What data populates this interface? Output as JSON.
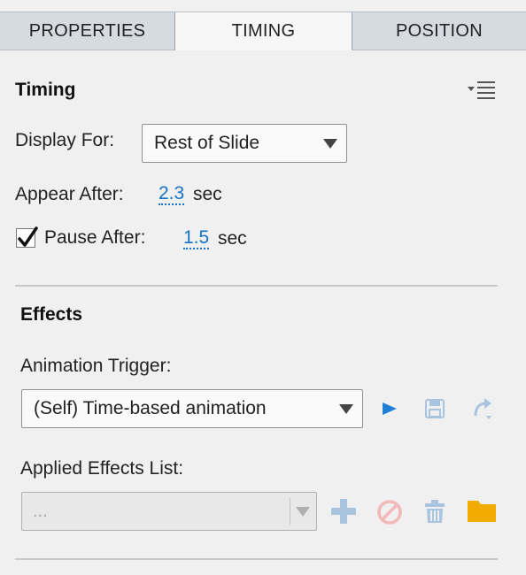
{
  "tabs": [
    {
      "label": "PROPERTIES",
      "active": false
    },
    {
      "label": "TIMING",
      "active": true
    },
    {
      "label": "POSITION",
      "active": false
    }
  ],
  "timing": {
    "title": "Timing",
    "display_for_label": "Display For:",
    "display_for_value": "Rest of Slide",
    "appear_after_label": "Appear After:",
    "appear_after_value": "2.3",
    "appear_after_unit": "sec",
    "pause_after_checked": true,
    "pause_after_label": "Pause After:",
    "pause_after_value": "1.5",
    "pause_after_unit": "sec"
  },
  "effects": {
    "title": "Effects",
    "animation_trigger_label": "Animation Trigger:",
    "animation_trigger_value": "(Self) Time-based animation",
    "applied_effects_label": "Applied Effects List:",
    "applied_effects_value": "..."
  },
  "colors": {
    "accent": "#1473c7",
    "disabled_icon": "#a9c4de",
    "disabled_red": "#f2b9b9",
    "folder": "#f0ac00"
  },
  "icons": {
    "panel_menu": "panel-menu-icon",
    "play": "play-icon",
    "save": "save-icon",
    "redo": "redo-icon",
    "add": "add-icon",
    "disable": "no-entry-icon",
    "delete": "trash-icon",
    "folder": "folder-icon"
  }
}
